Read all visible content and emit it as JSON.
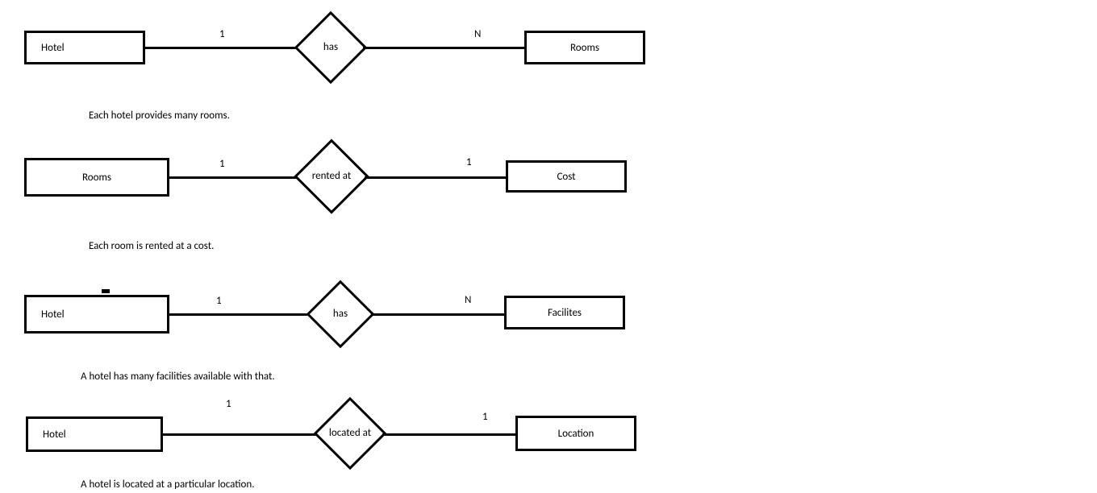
{
  "rows": [
    {
      "left_entity": "Hotel",
      "relationship": "has",
      "right_entity": "Rooms",
      "left_card": "1",
      "right_card": "N",
      "caption": "Each hotel provides many rooms."
    },
    {
      "left_entity": "Rooms",
      "relationship": "rented at",
      "right_entity": "Cost",
      "left_card": "1",
      "right_card": "1",
      "caption": "Each room is rented at a cost."
    },
    {
      "left_entity": "Hotel",
      "relationship": "has",
      "right_entity": "Facilites",
      "left_card": "1",
      "right_card": "N",
      "caption": "A hotel has many facilities available with that."
    },
    {
      "left_entity": "Hotel",
      "relationship": "located at",
      "right_entity": "Location",
      "left_card": "1",
      "right_card": "1",
      "caption": "A hotel is located at a particular location."
    }
  ]
}
